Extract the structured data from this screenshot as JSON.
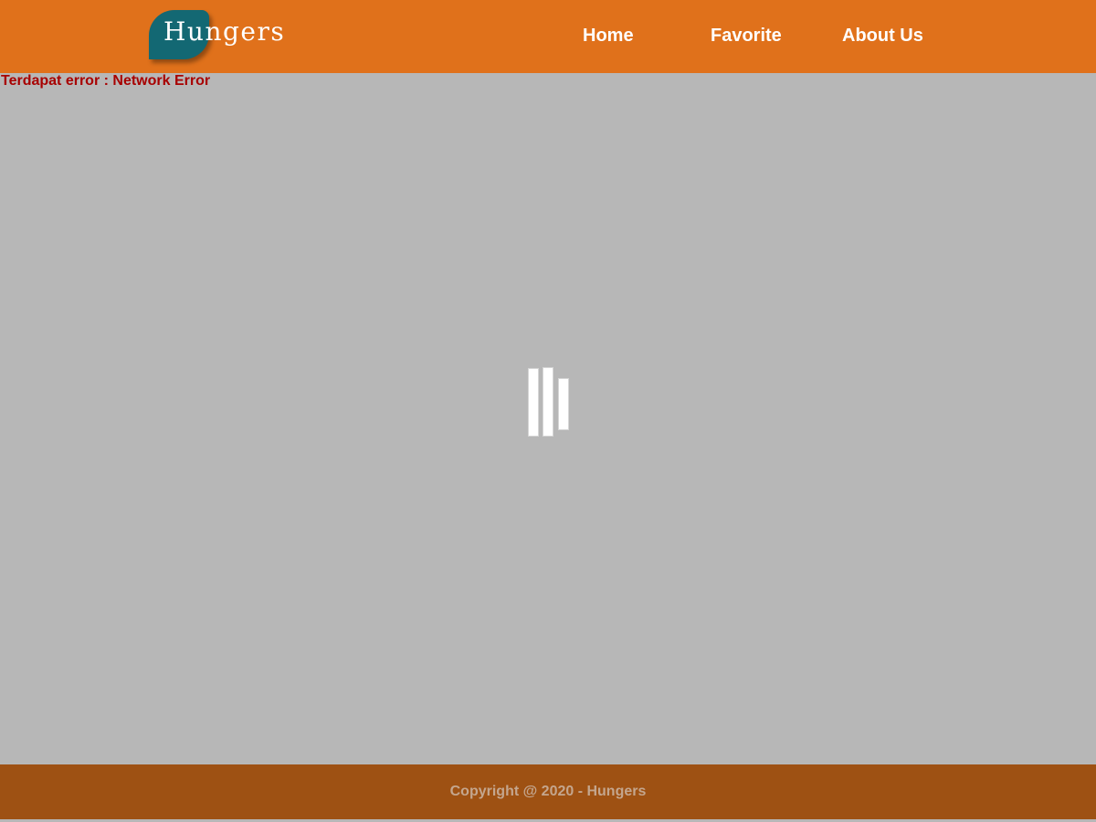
{
  "header": {
    "brand": "Hungers",
    "nav": [
      {
        "label": "Home"
      },
      {
        "label": "Favorite"
      },
      {
        "label": "About Us"
      }
    ]
  },
  "main": {
    "error_message": "Terdapat error : Network Error",
    "loader_icon": "loading-bars-icon"
  },
  "footer": {
    "copyright": "Copyright @ 2020 - Hungers"
  },
  "colors": {
    "header_bg": "#e0711b",
    "logo_bg": "#136873",
    "page_bg": "#b7b7b7",
    "error_text": "#a80000",
    "footer_bg": "#9e5113",
    "footer_text": "#c4a68e"
  }
}
